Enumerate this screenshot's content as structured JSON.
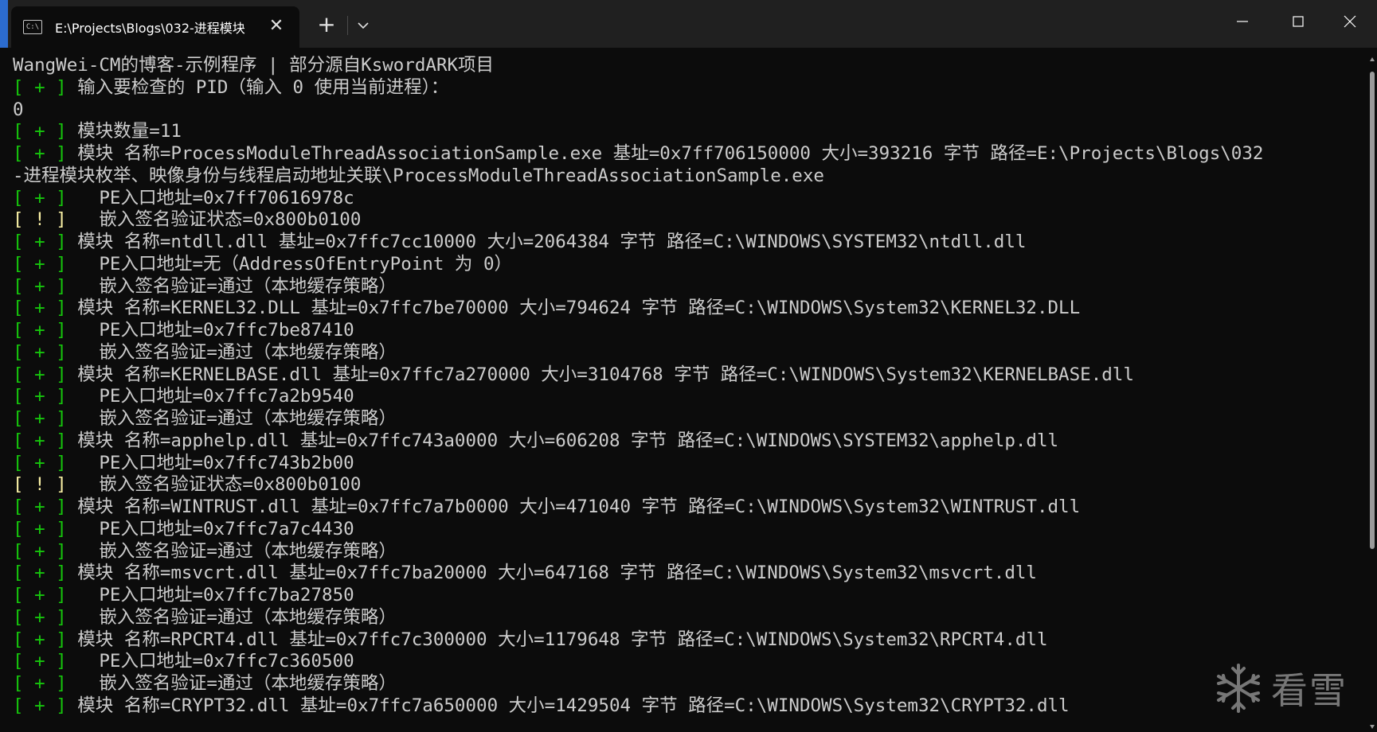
{
  "window": {
    "tab_title": "E:\\Projects\\Blogs\\032-进程模块",
    "tab_icon_text": "C:\\",
    "new_tab_symbol": "+",
    "close_symbol": "✕"
  },
  "console": {
    "lines": [
      {
        "tag": "",
        "text": "WangWei-CM的博客-示例程序 | 部分源自KswordARK项目"
      },
      {
        "tag": "[ + ]",
        "text": " 输入要检查的 PID（输入 0 使用当前进程）："
      },
      {
        "tag": "",
        "text": "0"
      },
      {
        "tag": "[ + ]",
        "text": " 模块数量=11"
      },
      {
        "tag": "[ + ]",
        "text": " 模块 名称=ProcessModuleThreadAssociationSample.exe 基址=0x7ff706150000 大小=393216 字节 路径=E:\\Projects\\Blogs\\032"
      },
      {
        "tag": "",
        "text": "-进程模块枚举、映像身份与线程启动地址关联\\ProcessModuleThreadAssociationSample.exe"
      },
      {
        "tag": "[ + ]",
        "text": "   PE入口地址=0x7ff70616978c"
      },
      {
        "tag": "[ ! ]",
        "text": "   嵌入签名验证状态=0x800b0100"
      },
      {
        "tag": "[ + ]",
        "text": " 模块 名称=ntdll.dll 基址=0x7ffc7cc10000 大小=2064384 字节 路径=C:\\WINDOWS\\SYSTEM32\\ntdll.dll"
      },
      {
        "tag": "[ + ]",
        "text": "   PE入口地址=无（AddressOfEntryPoint 为 0）"
      },
      {
        "tag": "[ + ]",
        "text": "   嵌入签名验证=通过（本地缓存策略）"
      },
      {
        "tag": "[ + ]",
        "text": " 模块 名称=KERNEL32.DLL 基址=0x7ffc7be70000 大小=794624 字节 路径=C:\\WINDOWS\\System32\\KERNEL32.DLL"
      },
      {
        "tag": "[ + ]",
        "text": "   PE入口地址=0x7ffc7be87410"
      },
      {
        "tag": "[ + ]",
        "text": "   嵌入签名验证=通过（本地缓存策略）"
      },
      {
        "tag": "[ + ]",
        "text": " 模块 名称=KERNELBASE.dll 基址=0x7ffc7a270000 大小=3104768 字节 路径=C:\\WINDOWS\\System32\\KERNELBASE.dll"
      },
      {
        "tag": "[ + ]",
        "text": "   PE入口地址=0x7ffc7a2b9540"
      },
      {
        "tag": "[ + ]",
        "text": "   嵌入签名验证=通过（本地缓存策略）"
      },
      {
        "tag": "[ + ]",
        "text": " 模块 名称=apphelp.dll 基址=0x7ffc743a0000 大小=606208 字节 路径=C:\\WINDOWS\\SYSTEM32\\apphelp.dll"
      },
      {
        "tag": "[ + ]",
        "text": "   PE入口地址=0x7ffc743b2b00"
      },
      {
        "tag": "[ ! ]",
        "text": "   嵌入签名验证状态=0x800b0100"
      },
      {
        "tag": "[ + ]",
        "text": " 模块 名称=WINTRUST.dll 基址=0x7ffc7a7b0000 大小=471040 字节 路径=C:\\WINDOWS\\System32\\WINTRUST.dll"
      },
      {
        "tag": "[ + ]",
        "text": "   PE入口地址=0x7ffc7a7c4430"
      },
      {
        "tag": "[ + ]",
        "text": "   嵌入签名验证=通过（本地缓存策略）"
      },
      {
        "tag": "[ + ]",
        "text": " 模块 名称=msvcrt.dll 基址=0x7ffc7ba20000 大小=647168 字节 路径=C:\\WINDOWS\\System32\\msvcrt.dll"
      },
      {
        "tag": "[ + ]",
        "text": "   PE入口地址=0x7ffc7ba27850"
      },
      {
        "tag": "[ + ]",
        "text": "   嵌入签名验证=通过（本地缓存策略）"
      },
      {
        "tag": "[ + ]",
        "text": " 模块 名称=RPCRT4.dll 基址=0x7ffc7c300000 大小=1179648 字节 路径=C:\\WINDOWS\\System32\\RPCRT4.dll"
      },
      {
        "tag": "[ + ]",
        "text": "   PE入口地址=0x7ffc7c360500"
      },
      {
        "tag": "[ + ]",
        "text": "   嵌入签名验证=通过（本地缓存策略）"
      },
      {
        "tag": "[ + ]",
        "text": " 模块 名称=CRYPT32.dll 基址=0x7ffc7a650000 大小=1429504 字节 路径=C:\\WINDOWS\\System32\\CRYPT32.dll"
      }
    ]
  },
  "watermark": {
    "text": "看雪"
  },
  "colors": {
    "ok_tag": "#16c60c",
    "warn_tag": "#f9f1a5",
    "text": "#cccccc",
    "background": "#0c0c0c",
    "titlebar": "#202020"
  }
}
